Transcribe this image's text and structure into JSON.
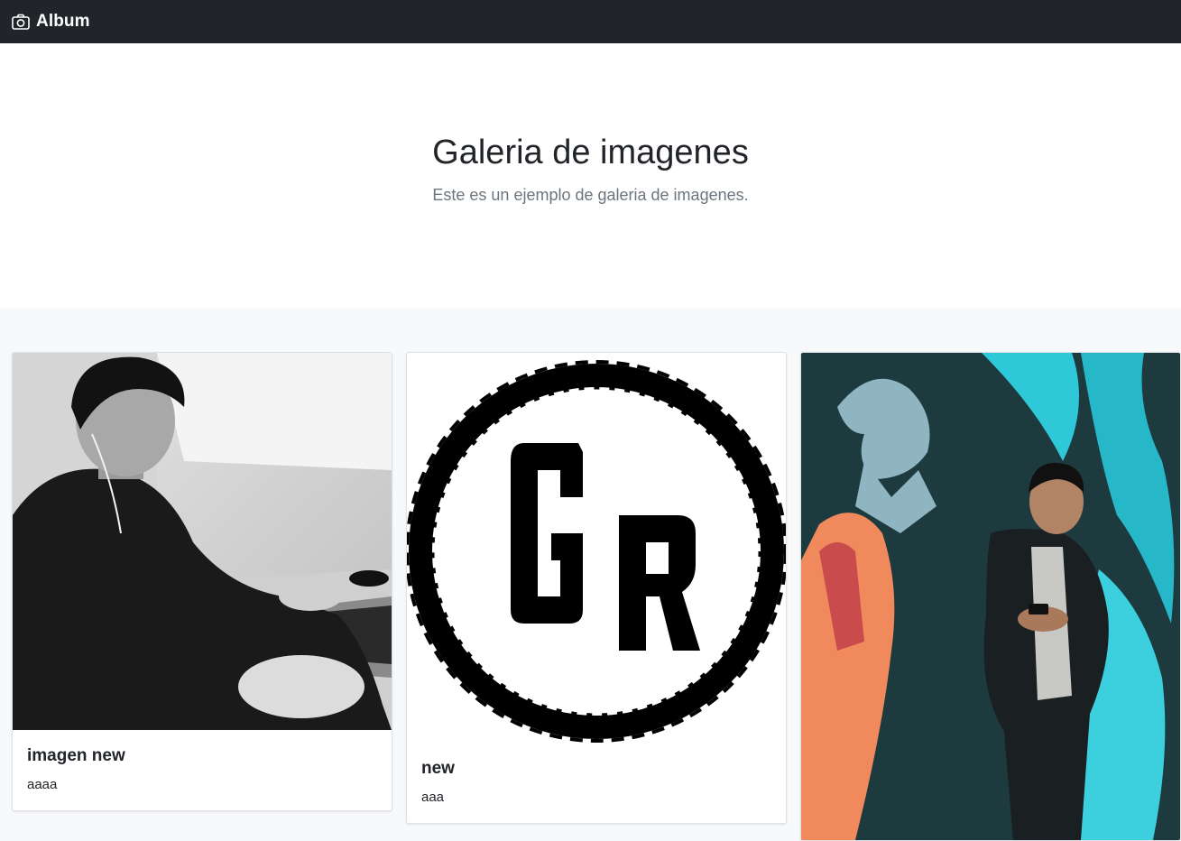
{
  "navbar": {
    "brand_icon": "camera-icon",
    "brand_label": "Album",
    "background": "#212529"
  },
  "hero": {
    "title": "Galeria de imagenes",
    "subtitle": "Este es un ejemplo de galeria de imagenes."
  },
  "cards": [
    {
      "title": "imagen new",
      "text": "aaaa",
      "image": "photo-man-at-laptop-bw"
    },
    {
      "title": "new",
      "text": "aaa",
      "image": "gr-logo-circle"
    },
    {
      "title": "",
      "text": "",
      "image": "photo-man-with-phone-mural"
    }
  ]
}
